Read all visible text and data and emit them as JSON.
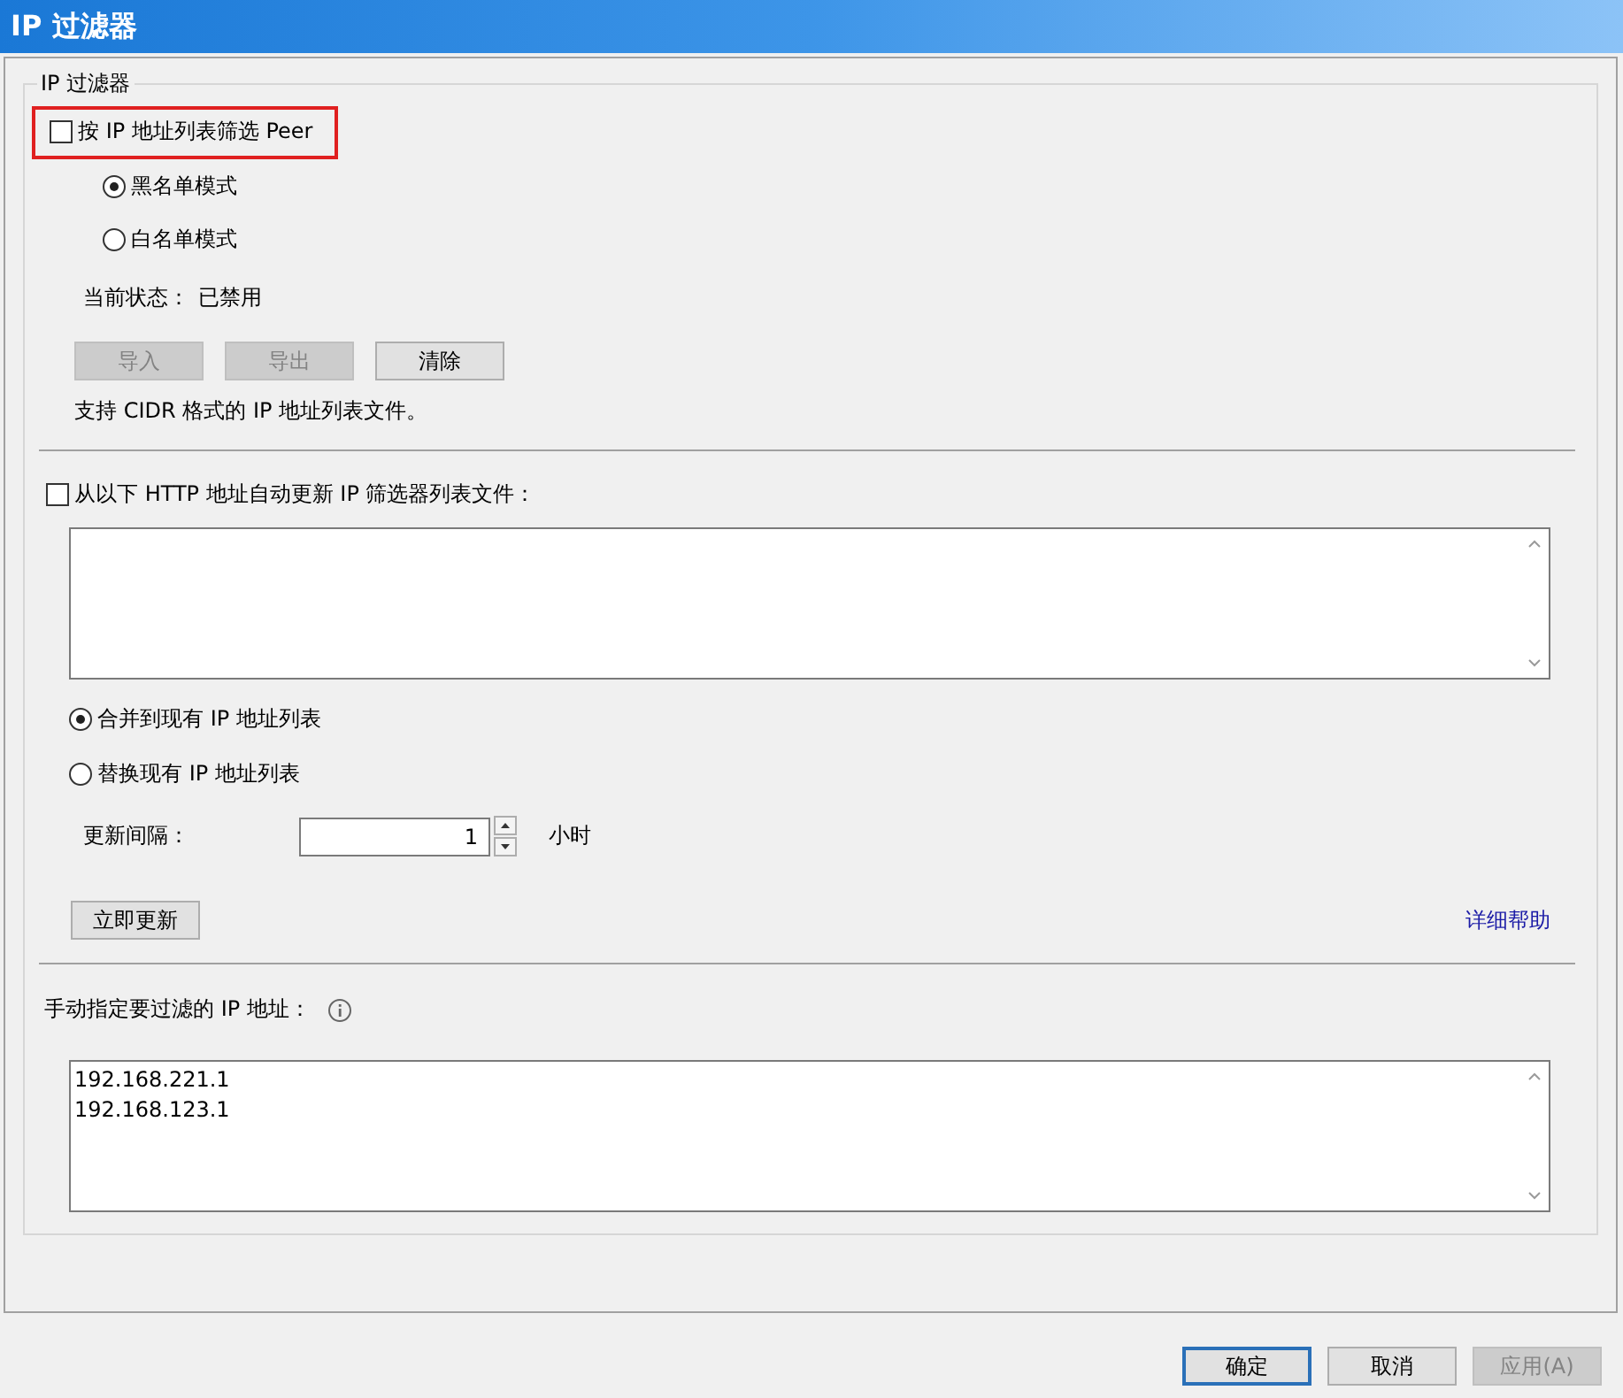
{
  "window": {
    "title": "IP 过滤器"
  },
  "group": {
    "title": "IP 过滤器"
  },
  "filter_checkbox": {
    "label": "按 IP 地址列表筛选 Peer",
    "checked": false,
    "highlighted": true
  },
  "mode_radios": [
    {
      "label": "黑名单模式",
      "selected": true
    },
    {
      "label": "白名单模式",
      "selected": false
    }
  ],
  "status": {
    "label": "当前状态：",
    "value": "已禁用"
  },
  "list_buttons": [
    {
      "label": "导入",
      "disabled": true
    },
    {
      "label": "导出",
      "disabled": true
    },
    {
      "label": "清除",
      "disabled": false
    }
  ],
  "hint": "支持 CIDR 格式的 IP 地址列表文件。",
  "auto_update_checkbox": {
    "label": "从以下 HTTP 地址自动更新 IP 筛选器列表文件：",
    "checked": false
  },
  "merge_radios": [
    {
      "label": "合并到现有 IP 地址列表",
      "selected": true
    },
    {
      "label": "替换现有 IP 地址列表",
      "selected": false
    }
  ],
  "interval": {
    "label": "更新间隔：",
    "value": "1",
    "unit": "小时"
  },
  "update_button": {
    "label": "立即更新"
  },
  "help_link": "详细帮助",
  "manual": {
    "label": "手动指定要过滤的 IP 地址：",
    "lines": [
      "192.168.221.1",
      "192.168.123.1"
    ]
  },
  "buttons": [
    {
      "label": "确定",
      "default": true,
      "disabled": false
    },
    {
      "label": "取消",
      "default": false,
      "disabled": false
    },
    {
      "label": "应用(A)",
      "default": false,
      "disabled": true
    }
  ]
}
